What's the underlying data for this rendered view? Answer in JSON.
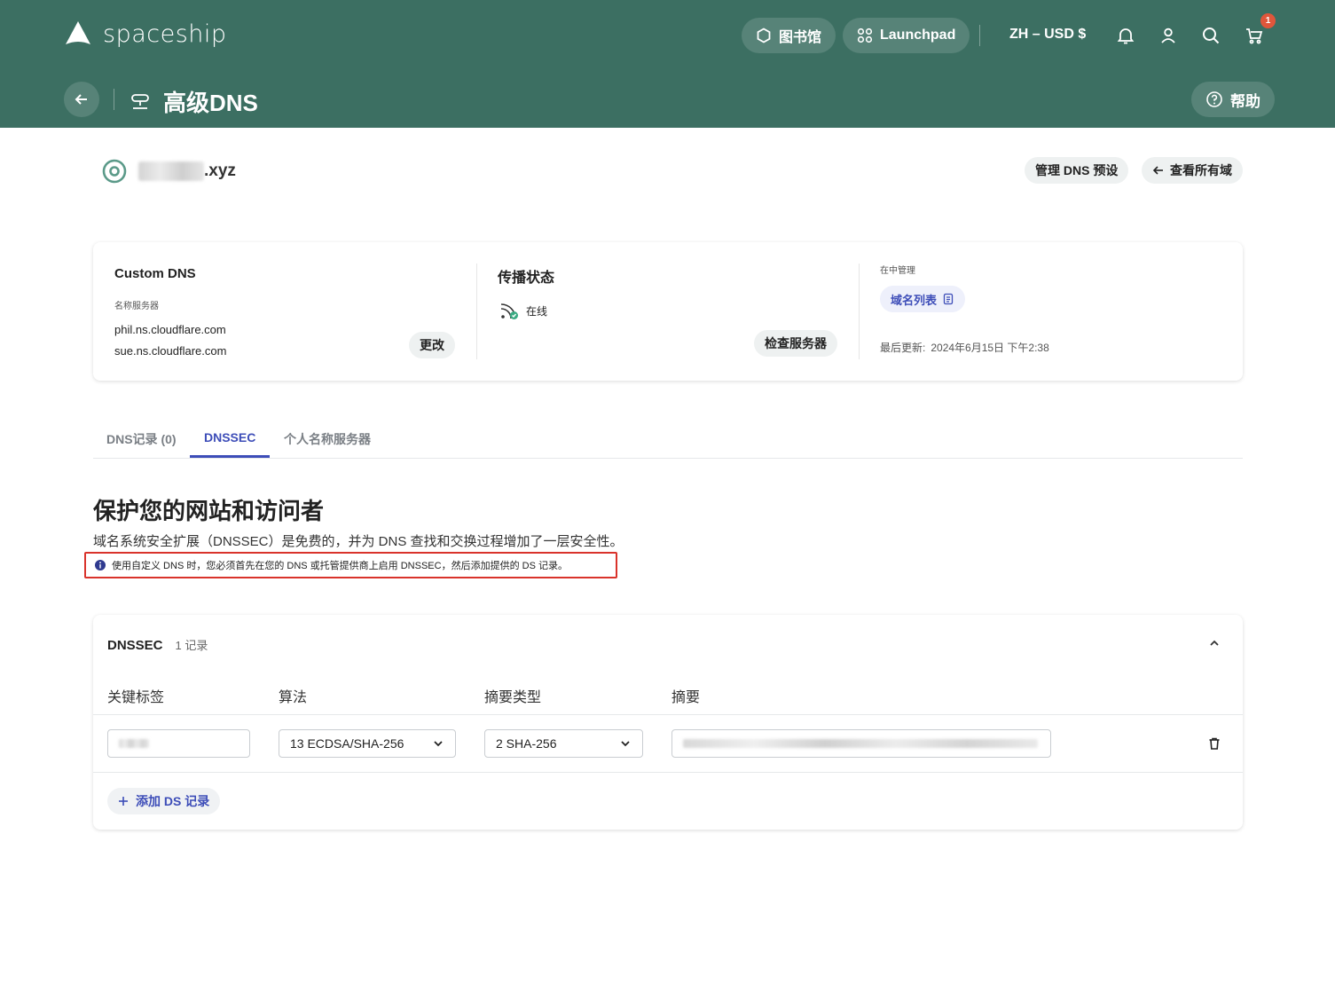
{
  "header": {
    "brand": "spaceship",
    "library_label": "图书馆",
    "launchpad_label": "Launchpad",
    "lang_currency": "ZH – USD $",
    "cart_badge": "1",
    "page_title": "高级DNS",
    "help_label": "帮助"
  },
  "domain": {
    "tld": ".xyz",
    "manage_presets_label": "管理 DNS 预设",
    "view_all_label": "查看所有域"
  },
  "info_card": {
    "custom_dns_title": "Custom DNS",
    "nameservers_label": "名称服务器",
    "nameservers": [
      "phil.ns.cloudflare.com",
      "sue.ns.cloudflare.com"
    ],
    "change_label": "更改",
    "propagation_title": "传播状态",
    "status_text": "在线",
    "check_servers_label": "检查服务器",
    "managed_in_label": "在中管理",
    "domain_list_label": "域名列表",
    "last_updated_label": "最后更新:",
    "last_updated_value": "2024年6月15日 下午2:38"
  },
  "tabs": [
    {
      "label": "DNS记录 (0)"
    },
    {
      "label": "DNSSEC"
    },
    {
      "label": "个人名称服务器"
    }
  ],
  "section": {
    "title": "保护您的网站和访问者",
    "description": "域名系统安全扩展（DNSSEC）是免费的，并为 DNS 查找和交换过程增加了一层安全性。",
    "notice": "使用自定义 DNS 时，您必须首先在您的 DNS 或托管提供商上启用 DNSSEC，然后添加提供的 DS 记录。"
  },
  "dnssec": {
    "title": "DNSSEC",
    "record_count": "1 记录",
    "columns": [
      "关键标签",
      "算法",
      "摘要类型",
      "摘要"
    ],
    "algorithm_value": "13 ECDSA/SHA-256",
    "digest_type_value": "2 SHA-256",
    "add_label": "添加 DS 记录"
  },
  "colors": {
    "header_bg": "#3c6f62",
    "accent": "#3d4db8",
    "notice_border": "#d9332b",
    "badge": "#e0563b"
  }
}
